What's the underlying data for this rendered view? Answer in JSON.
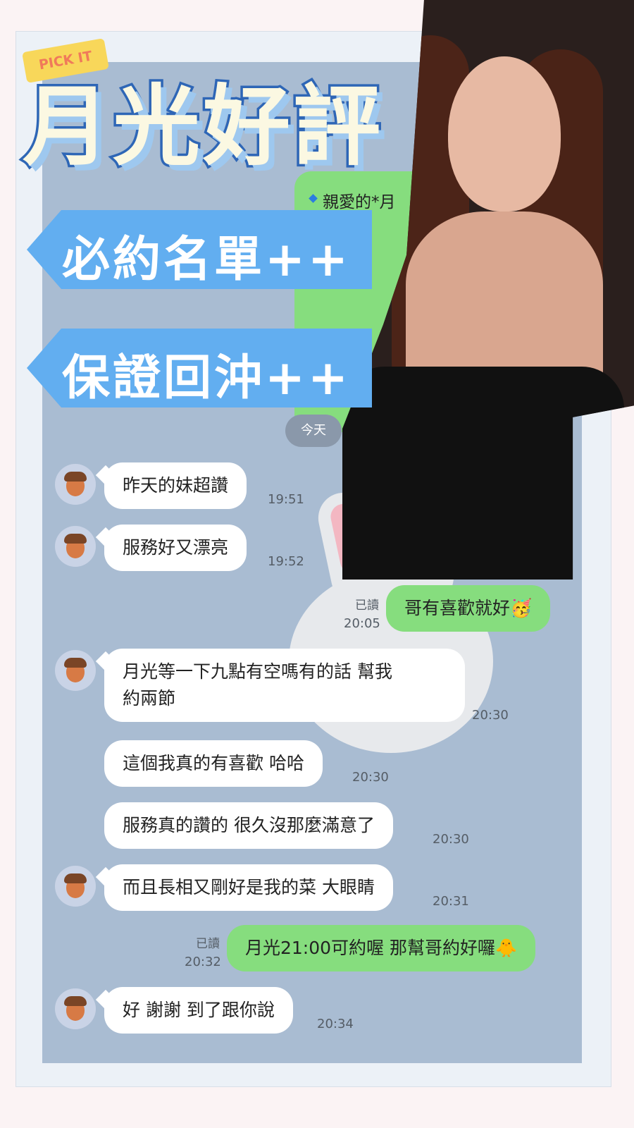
{
  "title": {
    "sticker": "PICK IT",
    "main": "月光好評",
    "banner1": "必約名單++",
    "banner2": "保證回沖++"
  },
  "chat": {
    "top_green_snippet": "親愛的*月",
    "date_label": "今天",
    "messages": [
      {
        "side": "left",
        "text": "昨天的妹超讚",
        "time": "19:51",
        "avatar": true
      },
      {
        "side": "left",
        "text": "服務好又漂亮",
        "time": "19:52",
        "avatar": true
      },
      {
        "side": "right",
        "text": "哥有喜歡就好🥳",
        "time": "20:05",
        "read": "已讀"
      },
      {
        "side": "left",
        "text": "月光等一下九點有空嗎有的話 幫我\n約兩節",
        "time": "20:30",
        "avatar": true
      },
      {
        "side": "left",
        "text": "這個我真的有喜歡 哈哈",
        "time": "20:30",
        "avatar": false
      },
      {
        "side": "left",
        "text": "服務真的讚的 很久沒那麼滿意了",
        "time": "20:30",
        "avatar": false
      },
      {
        "side": "left",
        "text": "而且長相又剛好是我的菜 大眼睛",
        "time": "20:31",
        "avatar": true
      },
      {
        "side": "right",
        "text": "月光21:00可約喔 那幫哥約好囉🐥",
        "time": "20:32",
        "read": "已讀"
      },
      {
        "side": "left",
        "text": "好 謝謝 到了跟你說",
        "time": "20:34",
        "avatar": true
      }
    ]
  },
  "colors": {
    "chat_bg": "#a9bcd2",
    "sent_bubble": "#86dd7e",
    "received_bubble": "#ffffff",
    "banner": "#62aef0",
    "title_stroke": "#2e66b6"
  }
}
